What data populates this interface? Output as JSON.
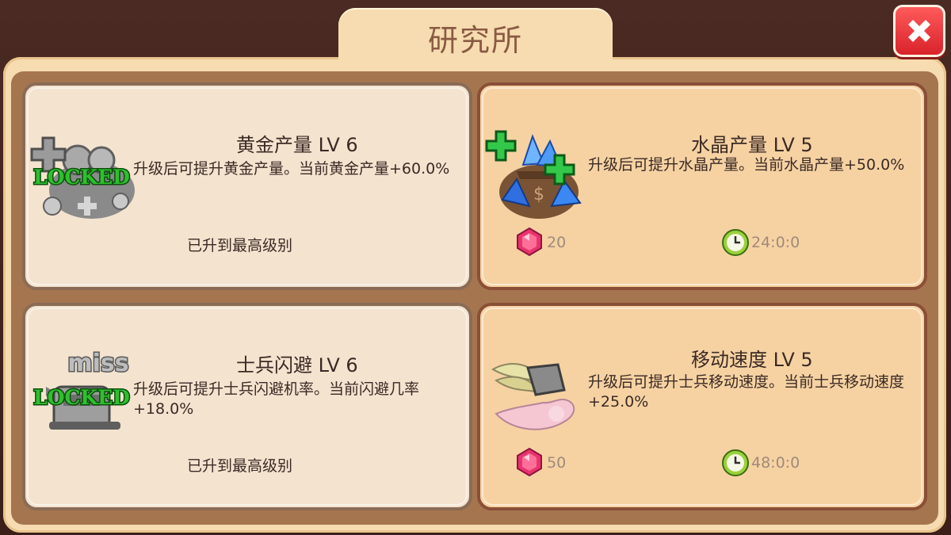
{
  "window": {
    "title": "研究所"
  },
  "close_button": {
    "icon": "close-icon"
  },
  "cards": [
    {
      "title": "黄金产量 LV 6",
      "description": "升级后可提升黄金产量。当前黄金产量+60.0%",
      "status": "已升到最高级别",
      "locked_label": "LOCKED",
      "icon": "gold-coins-icon"
    },
    {
      "title": "水晶产量 LV 5",
      "description": "升级后可提升水晶产量。当前水晶产量+50.0%",
      "cost": "20",
      "time": "24:0:0",
      "icon": "crystal-bag-icon"
    },
    {
      "title": "士兵闪避 LV 6",
      "description": "升级后可提升士兵闪避机率。当前闪避几率+18.0%",
      "status": "已升到最高级别",
      "locked_label": "LOCKED",
      "miss_label": "miss",
      "icon": "soldier-dodge-icon"
    },
    {
      "title": "移动速度 LV 5",
      "description": "升级后可提升士兵移动速度。当前士兵移动速度+25.0%",
      "cost": "50",
      "time": "48:0:0",
      "icon": "winged-boot-icon"
    }
  ],
  "colors": {
    "accent": "#d8232a",
    "panel": "#f6dcb0",
    "locked_text": "#1d8f1d"
  }
}
